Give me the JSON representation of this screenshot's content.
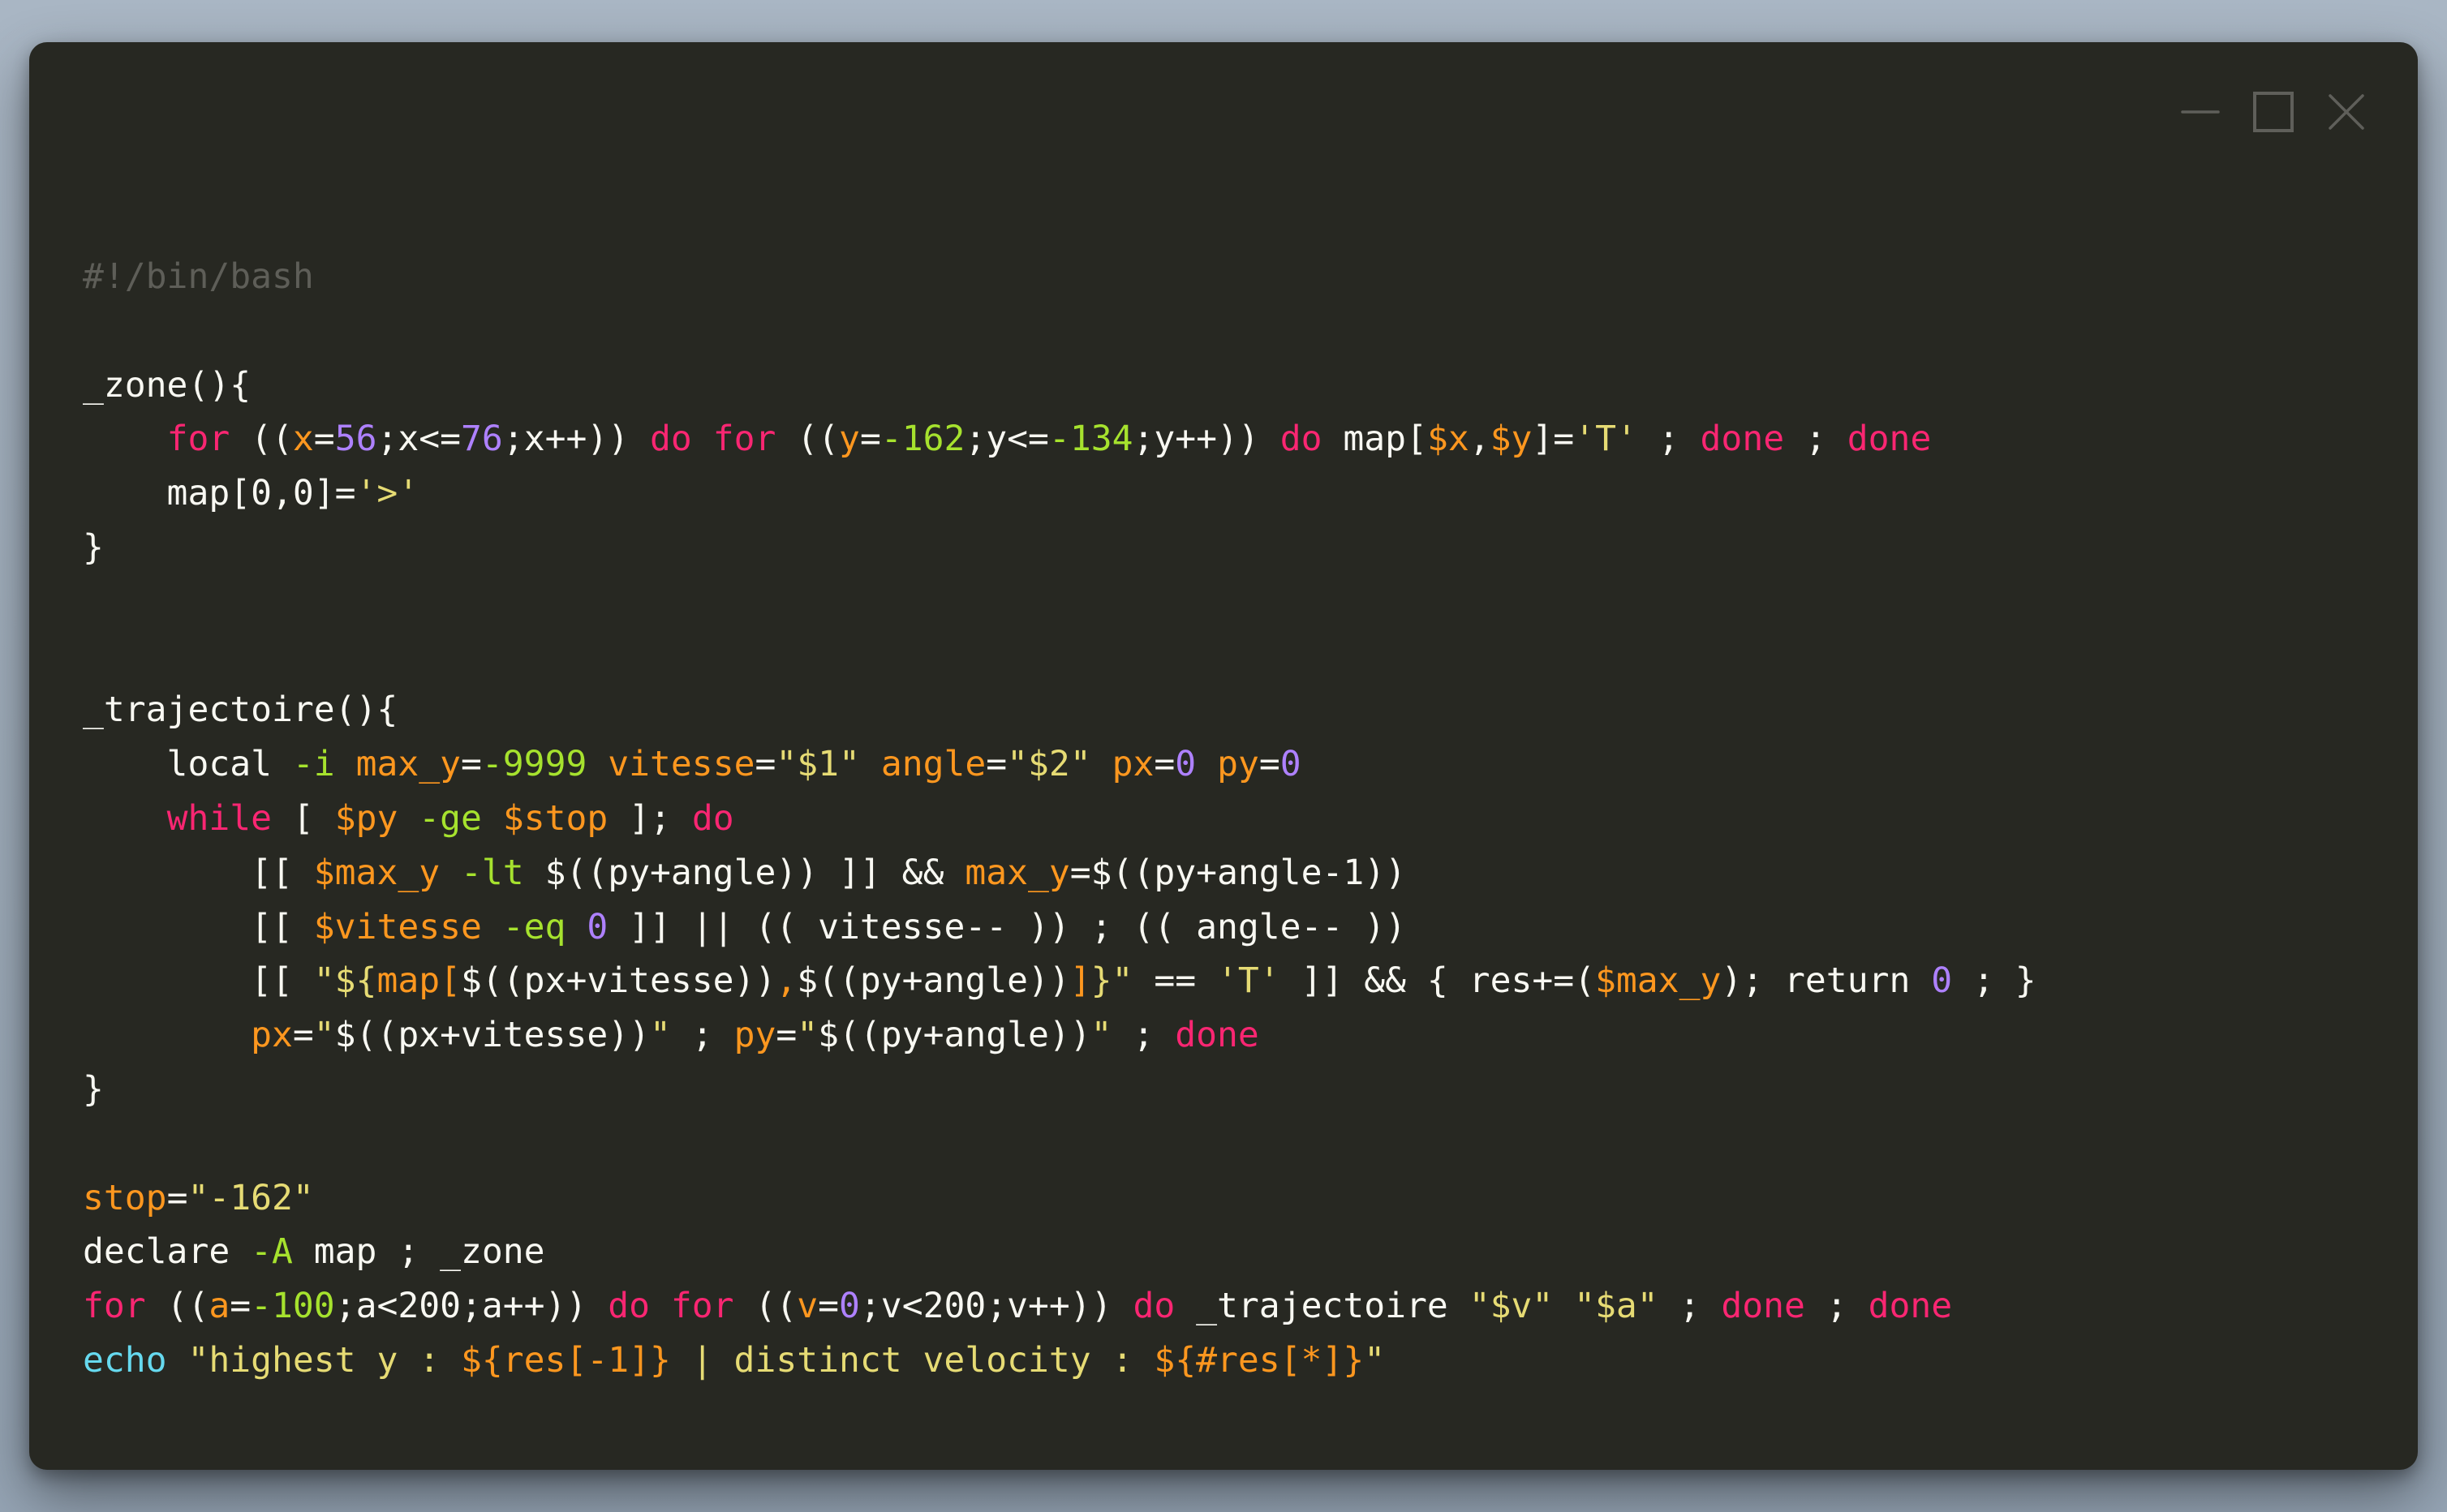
{
  "window": {
    "controls": {
      "minimize": "minimize-icon",
      "maximize": "maximize-icon",
      "close": "close-icon"
    }
  },
  "colors": {
    "background": "#272822",
    "plain": "#f8f8f2",
    "comment": "#5e5e58",
    "keyword": "#f92672",
    "variable": "#fd971f",
    "number": "#ae81ff",
    "string": "#e6db74",
    "option": "#a6e22e",
    "builtin": "#66d9ef"
  },
  "code": {
    "lines": [
      [
        [
          "comment",
          "#!/bin/bash"
        ]
      ],
      [],
      [
        [
          "plain",
          "_zone(){"
        ]
      ],
      [
        [
          "plain",
          "    "
        ],
        [
          "keyword",
          "for"
        ],
        [
          "plain",
          " (("
        ],
        [
          "var",
          "x"
        ],
        [
          "plain",
          "="
        ],
        [
          "number",
          "56"
        ],
        [
          "plain",
          ";x<="
        ],
        [
          "number",
          "76"
        ],
        [
          "plain",
          ";x++)) "
        ],
        [
          "keyword",
          "do"
        ],
        [
          "plain",
          " "
        ],
        [
          "keyword",
          "for"
        ],
        [
          "plain",
          " (("
        ],
        [
          "var",
          "y"
        ],
        [
          "plain",
          "="
        ],
        [
          "option",
          "-162"
        ],
        [
          "plain",
          ";y<="
        ],
        [
          "option",
          "-134"
        ],
        [
          "plain",
          ";y++)) "
        ],
        [
          "keyword",
          "do"
        ],
        [
          "plain",
          " map["
        ],
        [
          "var",
          "$x"
        ],
        [
          "plain",
          ","
        ],
        [
          "var",
          "$y"
        ],
        [
          "plain",
          "]="
        ],
        [
          "string",
          "'T'"
        ],
        [
          "plain",
          " ; "
        ],
        [
          "keyword",
          "done"
        ],
        [
          "plain",
          " ; "
        ],
        [
          "keyword",
          "done"
        ]
      ],
      [
        [
          "plain",
          "    map[0,0]="
        ],
        [
          "string",
          "'>'"
        ]
      ],
      [
        [
          "plain",
          "}"
        ]
      ],
      [],
      [],
      [
        [
          "plain",
          "_trajectoire(){"
        ]
      ],
      [
        [
          "plain",
          "    local "
        ],
        [
          "option",
          "-i"
        ],
        [
          "plain",
          " "
        ],
        [
          "var",
          "max_y"
        ],
        [
          "plain",
          "="
        ],
        [
          "option",
          "-9999"
        ],
        [
          "plain",
          " "
        ],
        [
          "var",
          "vitesse"
        ],
        [
          "plain",
          "="
        ],
        [
          "string",
          "\"$1\""
        ],
        [
          "plain",
          " "
        ],
        [
          "var",
          "angle"
        ],
        [
          "plain",
          "="
        ],
        [
          "string",
          "\"$2\""
        ],
        [
          "plain",
          " "
        ],
        [
          "var",
          "px"
        ],
        [
          "plain",
          "="
        ],
        [
          "number",
          "0"
        ],
        [
          "plain",
          " "
        ],
        [
          "var",
          "py"
        ],
        [
          "plain",
          "="
        ],
        [
          "number",
          "0"
        ]
      ],
      [
        [
          "plain",
          "    "
        ],
        [
          "keyword",
          "while"
        ],
        [
          "plain",
          " [ "
        ],
        [
          "var",
          "$py"
        ],
        [
          "plain",
          " "
        ],
        [
          "option",
          "-ge"
        ],
        [
          "plain",
          " "
        ],
        [
          "var",
          "$stop"
        ],
        [
          "plain",
          " ]; "
        ],
        [
          "keyword",
          "do"
        ]
      ],
      [
        [
          "plain",
          "        [[ "
        ],
        [
          "var",
          "$max_y"
        ],
        [
          "plain",
          " "
        ],
        [
          "option",
          "-lt"
        ],
        [
          "plain",
          " $((py+angle)) ]] && "
        ],
        [
          "var",
          "max_y"
        ],
        [
          "plain",
          "=$((py+angle-1))"
        ]
      ],
      [
        [
          "plain",
          "        [[ "
        ],
        [
          "var",
          "$vitesse"
        ],
        [
          "plain",
          " "
        ],
        [
          "option",
          "-eq"
        ],
        [
          "plain",
          " "
        ],
        [
          "number",
          "0"
        ],
        [
          "plain",
          " ]] || (( vitesse-- )) ; (( angle-- ))"
        ]
      ],
      [
        [
          "plain",
          "        [[ "
        ],
        [
          "string",
          "\"${"
        ],
        [
          "var",
          "map["
        ],
        [
          "plain",
          "$((px+vitesse))"
        ],
        [
          "var",
          ","
        ],
        [
          "plain",
          "$((py+angle))"
        ],
        [
          "var",
          "]"
        ],
        [
          "string",
          "}\""
        ],
        [
          "plain",
          " == "
        ],
        [
          "string",
          "'T'"
        ],
        [
          "plain",
          " ]] && { res+=("
        ],
        [
          "var",
          "$max_y"
        ],
        [
          "plain",
          "); return "
        ],
        [
          "number",
          "0"
        ],
        [
          "plain",
          " ; }"
        ]
      ],
      [
        [
          "plain",
          "        "
        ],
        [
          "var",
          "px"
        ],
        [
          "plain",
          "="
        ],
        [
          "string",
          "\""
        ],
        [
          "plain",
          "$((px+vitesse))"
        ],
        [
          "string",
          "\""
        ],
        [
          "plain",
          " ; "
        ],
        [
          "var",
          "py"
        ],
        [
          "plain",
          "="
        ],
        [
          "string",
          "\""
        ],
        [
          "plain",
          "$((py+angle))"
        ],
        [
          "string",
          "\""
        ],
        [
          "plain",
          " ; "
        ],
        [
          "keyword",
          "done"
        ]
      ],
      [
        [
          "plain",
          "}"
        ]
      ],
      [],
      [
        [
          "var",
          "stop"
        ],
        [
          "plain",
          "="
        ],
        [
          "string",
          "\"-162\""
        ]
      ],
      [
        [
          "plain",
          "declare "
        ],
        [
          "option",
          "-A"
        ],
        [
          "plain",
          " map ; _zone"
        ]
      ],
      [
        [
          "keyword",
          "for"
        ],
        [
          "plain",
          " (("
        ],
        [
          "var",
          "a"
        ],
        [
          "plain",
          "="
        ],
        [
          "option",
          "-100"
        ],
        [
          "plain",
          ";a<200;a++)) "
        ],
        [
          "keyword",
          "do"
        ],
        [
          "plain",
          " "
        ],
        [
          "keyword",
          "for"
        ],
        [
          "plain",
          " (("
        ],
        [
          "var",
          "v"
        ],
        [
          "plain",
          "="
        ],
        [
          "number",
          "0"
        ],
        [
          "plain",
          ";v<200;v++)) "
        ],
        [
          "keyword",
          "do"
        ],
        [
          "plain",
          " _trajectoire "
        ],
        [
          "string",
          "\"$v\""
        ],
        [
          "plain",
          " "
        ],
        [
          "string",
          "\"$a\""
        ],
        [
          "plain",
          " ; "
        ],
        [
          "keyword",
          "done"
        ],
        [
          "plain",
          " ; "
        ],
        [
          "keyword",
          "done"
        ]
      ],
      [
        [
          "builtin",
          "echo"
        ],
        [
          "plain",
          " "
        ],
        [
          "string",
          "\"highest y : "
        ],
        [
          "var",
          "${res[-1]}"
        ],
        [
          "string",
          " | distinct velocity : "
        ],
        [
          "var",
          "${#res[*]}"
        ],
        [
          "string",
          "\""
        ]
      ]
    ]
  }
}
